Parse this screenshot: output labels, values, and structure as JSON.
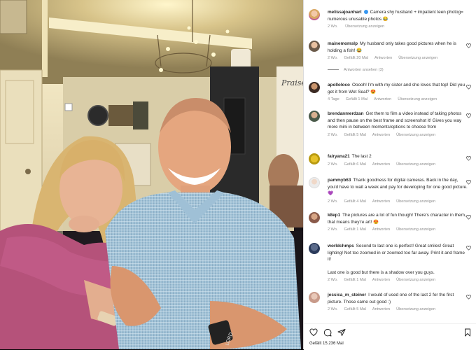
{
  "post": {
    "likes_text": "Gefällt 15.236 Mal",
    "image": {
      "sign_text": "Praise",
      "bracelet_text": "LORD"
    }
  },
  "caption": {
    "username": "melissajoanhart",
    "text": "Camera shy husband + impatient teen photog= numerous unusable photos 😂",
    "time": "2 Wo.",
    "action": "Übersetzung anzeigen"
  },
  "comments": [
    {
      "username": "mainemomslp",
      "text": "My husband only takes good pictures when he is holding a fish! 😂",
      "time": "2 Wo.",
      "likes": "Gefällt 20 Mal",
      "reply": "Antworten",
      "translate": "Übersetzung anzeigen"
    },
    {
      "username": "apolloloco",
      "text": "Ooooh! I'm with my sister and she loves that top! Did you get it from Wet Seal? 😍",
      "time": "4 Tage",
      "likes": "Gefällt 1 Mal",
      "reply": "Antworten",
      "translate": "Übersetzung anzeigen"
    },
    {
      "username": "brendanmerdzan",
      "text": "Get them to film a video instead of taking photos and then pause on the best frame and screenshot it! Gives you way more mini in between moments/options to choose from",
      "time": "2 Wo.",
      "likes": "Gefällt 5 Mal",
      "reply": "Antworten",
      "translate": "Übersetzung anzeigen"
    },
    {
      "username": "fairyana21",
      "text": "The last 2",
      "time": "2 Wo.",
      "likes": "Gefällt 6 Mal",
      "reply": "Antworten",
      "translate": "Übersetzung anzeigen"
    },
    {
      "username": "pammyb63",
      "text": "Thank goodness for digital cameras. Back in the day, you'd have to wait a week and pay for developing for one good picture. 💜",
      "time": "2 Wo.",
      "likes": "Gefällt 4 Mal",
      "reply": "Antworten",
      "translate": "Übersetzung anzeigen"
    },
    {
      "username": "k8ep1",
      "text": "The pictures are a lot of fun though! There's character in them, that means they're art! 😍",
      "time": "2 Wo.",
      "likes": "Gefällt 1 Mal",
      "reply": "Antworten",
      "translate": "Übersetzung anzeigen"
    },
    {
      "username": "worldchmps",
      "text": "Second to last one is perfect! Great smiles! Great lighting! Not too zoomed in or zoomed too far away. Print it and frame it!",
      "text2": "Last one is good but there is a shadow over you guys.",
      "time": "2 Wo.",
      "likes": "Gefällt 1 Mal",
      "reply": "Antworten",
      "translate": "Übersetzung anzeigen"
    },
    {
      "username": "jessica_m_steiner",
      "text": "I would of used one of the last 2 for the first picture. Those came out good :)",
      "time": "2 Wo.",
      "likes": "Gefällt 5 Mal",
      "reply": "Antworten",
      "translate": "Übersetzung anzeigen"
    }
  ],
  "view_replies": "Antworten ansehen (3)",
  "colors": {
    "verified": "#3897f0",
    "meta": "#8e8e8e",
    "text": "#262626"
  }
}
